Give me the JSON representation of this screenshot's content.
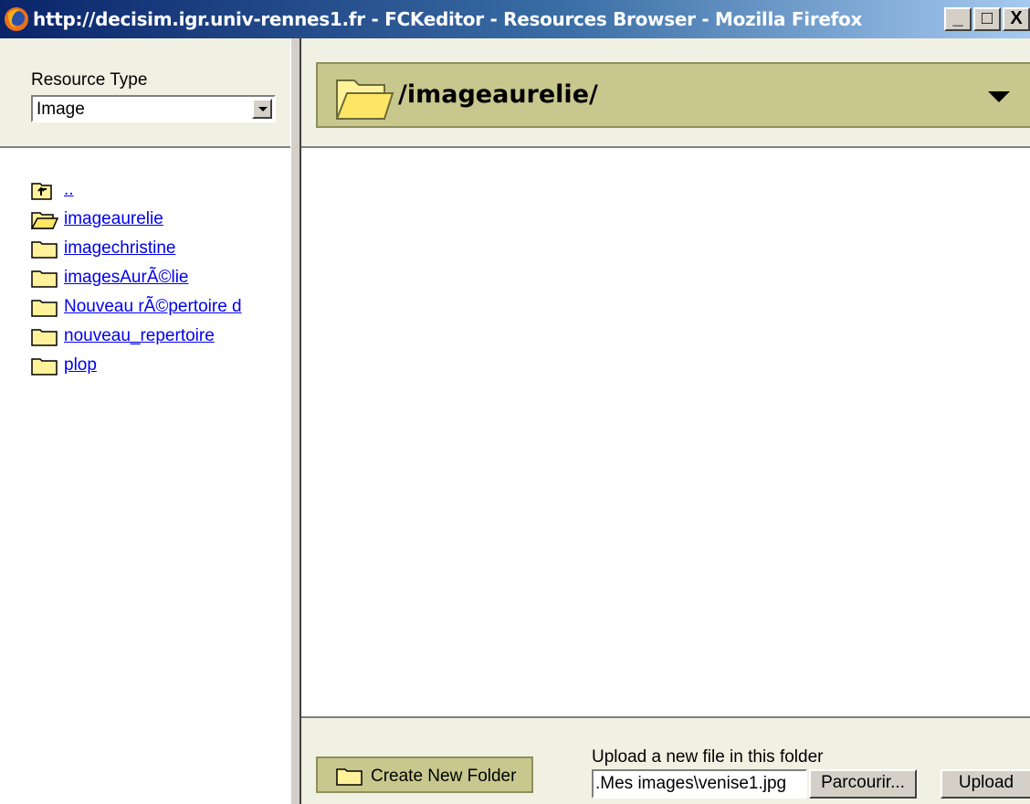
{
  "window": {
    "title": "http://decisim.igr.univ-rennes1.fr - FCKeditor - Resources Browser - Mozilla Firefox",
    "minimize_label": "_",
    "maximize_label": "□",
    "close_label": "X"
  },
  "resource_type": {
    "label": "Resource Type",
    "selected": "Image"
  },
  "tree": {
    "up_label": "..",
    "items": [
      {
        "label": "imageaurelie",
        "icon": "folder-open-icon"
      },
      {
        "label": "imagechristine",
        "icon": "folder-icon"
      },
      {
        "label": "imagesAurÃ©lie",
        "icon": "folder-icon"
      },
      {
        "label": "Nouveau rÃ©pertoire d",
        "icon": "folder-icon"
      },
      {
        "label": "nouveau_repertoire",
        "icon": "folder-icon"
      },
      {
        "label": "plop",
        "icon": "folder-icon"
      }
    ]
  },
  "current_folder": {
    "path": "/imageaurelie/"
  },
  "bottom": {
    "create_folder_label": "Create New Folder",
    "upload_label": "Upload a new file in this folder",
    "upload_path_value": ".Mes images\\venise1.jpg",
    "browse_label": "Parcourir...",
    "upload_button_label": "Upload"
  },
  "colors": {
    "panel_bg": "#f1f1e3",
    "folder_bar_bg": "#c8c88e",
    "link": "#0000ee",
    "folder_yellow": "#fff29a"
  }
}
